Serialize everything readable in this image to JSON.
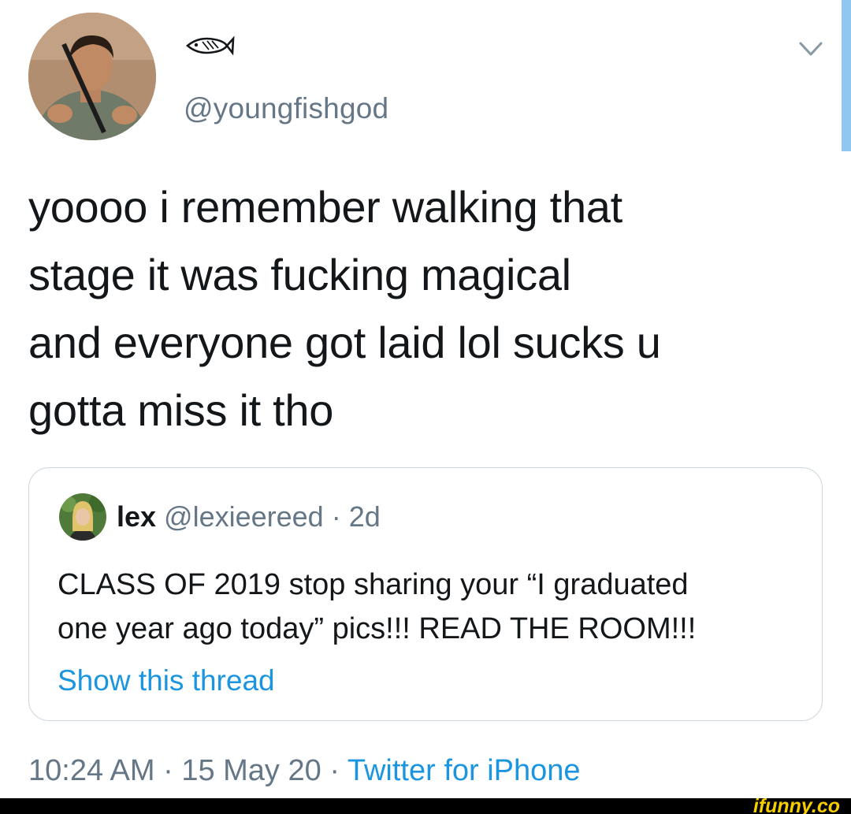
{
  "tweet": {
    "display_name_icon": "fish-icon",
    "handle": "@youngfishgod",
    "lines": [
      "yoooo i remember walking that",
      "stage it was fucking magical",
      "and everyone got laid lol sucks u",
      "gotta miss it tho"
    ],
    "timestamp": "10:24 AM · 15 May 20 · ",
    "source": "Twitter for iPhone"
  },
  "quoted": {
    "name": "lex",
    "meta": " @lexieereed · 2d",
    "lines": [
      "CLASS OF 2019 stop sharing your “I graduated",
      "one year ago today” pics!!! READ THE ROOM!!!"
    ],
    "link": "Show this thread"
  },
  "watermark": "ifunny.co",
  "colors": {
    "text": "#14171a",
    "muted": "#657786",
    "link": "#1b95e0",
    "border": "#ccd6dd"
  }
}
